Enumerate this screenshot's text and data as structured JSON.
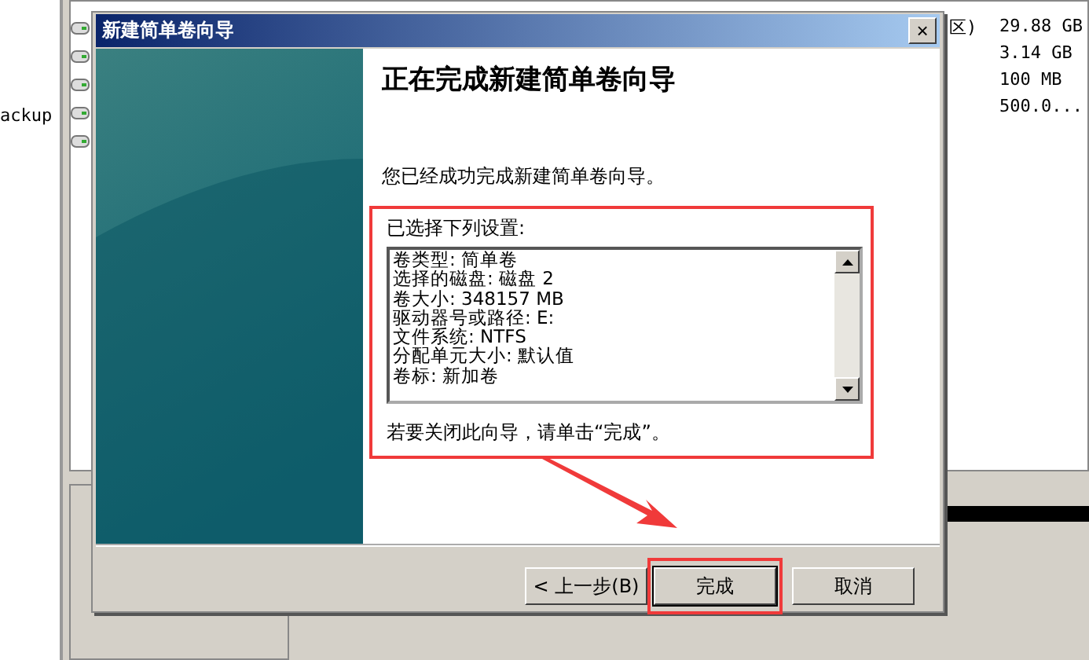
{
  "background": {
    "left_label": "ackup",
    "partition_label": "区)",
    "sizes": [
      "29.88 GB",
      "3.14 GB",
      "100 MB",
      "500.0..."
    ]
  },
  "dialog": {
    "title": "新建简单卷向导",
    "close": "×",
    "heading": "正在完成新建简单卷向导",
    "intro": "您已经成功完成新建简单卷向导。",
    "settings_label": "已选择下列设置:",
    "settings": [
      "卷类型: 简单卷",
      "选择的磁盘: 磁盘 2",
      "卷大小: 348157 MB",
      "驱动器号或路径: E:",
      "文件系统: NTFS",
      "分配单元大小: 默认值",
      "卷标: 新加卷"
    ],
    "close_hint": "若要关闭此向导，请单击“完成”。",
    "buttons": [
      {
        "kind": "back",
        "label": "< 上一步(B)",
        "highlighted": false
      },
      {
        "kind": "finish",
        "label": "完成",
        "highlighted": true
      },
      {
        "kind": "cancel",
        "label": "取消",
        "highlighted": false
      }
    ]
  }
}
